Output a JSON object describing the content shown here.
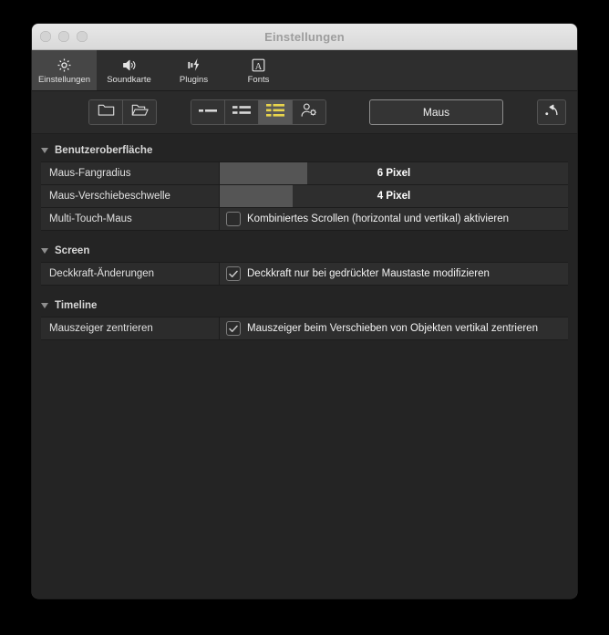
{
  "window": {
    "title": "Einstellungen",
    "traffic_lights": [
      "close-button",
      "minimize-button",
      "zoom-button"
    ]
  },
  "tabs": [
    {
      "label": "Einstellungen",
      "icon": "gear-icon",
      "active": true
    },
    {
      "label": "Soundkarte",
      "icon": "speaker-icon",
      "active": false
    },
    {
      "label": "Plugins",
      "icon": "plug-lightning-icon",
      "active": false
    },
    {
      "label": "Fonts",
      "icon": "letter-a-icon",
      "active": false
    }
  ],
  "toolbar": {
    "folder_buttons": [
      {
        "icon": "new-folder-icon"
      },
      {
        "icon": "open-folder-icon"
      }
    ],
    "view_buttons": [
      {
        "icon": "list-compact-icon",
        "active": false
      },
      {
        "icon": "list-medium-icon",
        "active": false
      },
      {
        "icon": "list-large-icon",
        "active": true
      },
      {
        "icon": "user-settings-icon",
        "active": false
      }
    ],
    "mode_button": "Maus",
    "revert_button_icon": "undo-arrow-icon",
    "accent_color": "#e8d44d"
  },
  "sections": [
    {
      "title": "Benutzeroberfläche",
      "rows": [
        {
          "label": "Maus-Fangradius",
          "type": "slider",
          "value": "6 Pixel",
          "fill_percent": 25
        },
        {
          "label": "Maus-Verschiebeschwelle",
          "type": "slider",
          "value": "4 Pixel",
          "fill_percent": 21
        },
        {
          "label": "Multi-Touch-Maus",
          "type": "checkbox",
          "checked": false,
          "check_label": "Kombiniertes Scrollen (horizontal und vertikal) aktivieren"
        }
      ]
    },
    {
      "title": "Screen",
      "rows": [
        {
          "label": "Deckkraft-Änderungen",
          "type": "checkbox",
          "checked": true,
          "check_label": "Deckkraft nur bei gedrückter Maustaste modifizieren"
        }
      ]
    },
    {
      "title": "Timeline",
      "rows": [
        {
          "label": "Mauszeiger zentrieren",
          "type": "checkbox",
          "checked": true,
          "check_label": "Mauszeiger beim Verschieben von Objekten vertikal zentrieren"
        }
      ]
    }
  ]
}
